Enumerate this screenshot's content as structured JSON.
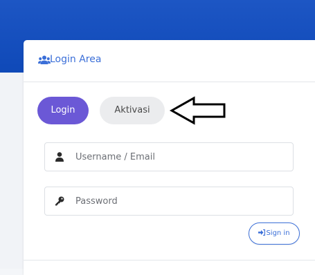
{
  "header": {
    "title": "Login Area",
    "icon": "users-icon"
  },
  "tabs": {
    "login_label": "Login",
    "aktivasi_label": "Aktivasi"
  },
  "form": {
    "username": {
      "placeholder": "Username / Email",
      "value": "",
      "icon": "user-icon"
    },
    "password": {
      "placeholder": "Password",
      "value": "",
      "icon": "key-icon"
    },
    "signin_label": "Sign in",
    "signin_icon": "sign-in-icon"
  },
  "colors": {
    "brand_blue": "#1d56c4",
    "login_purple": "#6b58d6",
    "link_blue": "#3b6fd8"
  }
}
